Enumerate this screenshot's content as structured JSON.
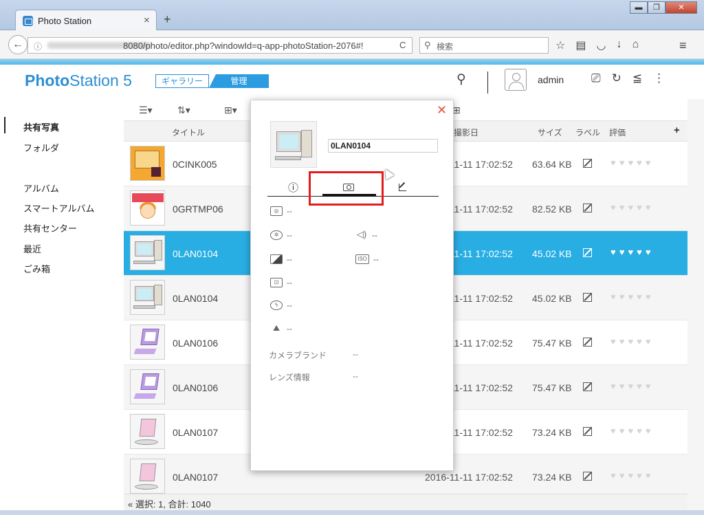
{
  "browser": {
    "tab_title": "Photo Station",
    "tab_close": "×",
    "new_tab": "+",
    "url_info": "ⓘ",
    "url": "8080/photo/editor.php?windowId=q-app-photoStation-2076#!",
    "search_placeholder": "検索",
    "window_buttons": [
      "▬",
      "❐",
      "✕"
    ],
    "reload": "C"
  },
  "app": {
    "logo_bold": "Photo",
    "logo_rest": "Station 5",
    "nav_gallery": "ギャラリー",
    "nav_manage": "管理",
    "username": "admin"
  },
  "sidebar": {
    "items": [
      "共有写真",
      "フォルダ",
      "アルバム",
      "スマートアルバム",
      "共有センター",
      "最近",
      "ごみ箱"
    ]
  },
  "columns": {
    "title": "タイトル",
    "date": "撮影日",
    "size": "サイズ",
    "label": "ラベル",
    "rating": "評価",
    "add": "+"
  },
  "rows": [
    {
      "title": "0CINK005",
      "date": "2016-11-11 17:02:52",
      "size": "63.64 KB"
    },
    {
      "title": "0GRTMP06",
      "date": "2016-11-11 17:02:52",
      "size": "82.52 KB"
    },
    {
      "title": "0LAN0104",
      "date": "2016-11-11 17:02:52",
      "size": "45.02 KB"
    },
    {
      "title": "0LAN0104",
      "date": "2016-11-11 17:02:52",
      "size": "45.02 KB"
    },
    {
      "title": "0LAN0106",
      "date": "2016-11-11 17:02:52",
      "size": "75.47 KB"
    },
    {
      "title": "0LAN0106",
      "date": "2016-11-11 17:02:52",
      "size": "75.47 KB"
    },
    {
      "title": "0LAN0107",
      "date": "2016-11-11 17:02:52",
      "size": "73.24 KB"
    },
    {
      "title": "0LAN0107",
      "date": "2016-11-11 17:02:52",
      "size": "73.24 KB"
    }
  ],
  "hearts": "♥♥♥♥♥",
  "status": "« 選択: 1, 合計: 1040",
  "popup": {
    "close": "✕",
    "filename": "0LAN0104",
    "info_tab_icon": "ⓘ",
    "dash": "--",
    "camera_brand_label": "カメラブランド",
    "camera_brand_value": "--",
    "lens_label": "レンズ情報",
    "lens_value": "--",
    "iso": "ISO"
  },
  "colors": {
    "accent": "#2b9ce0",
    "selected_row": "#29aee3",
    "highlight_box": "#e31c1c"
  }
}
